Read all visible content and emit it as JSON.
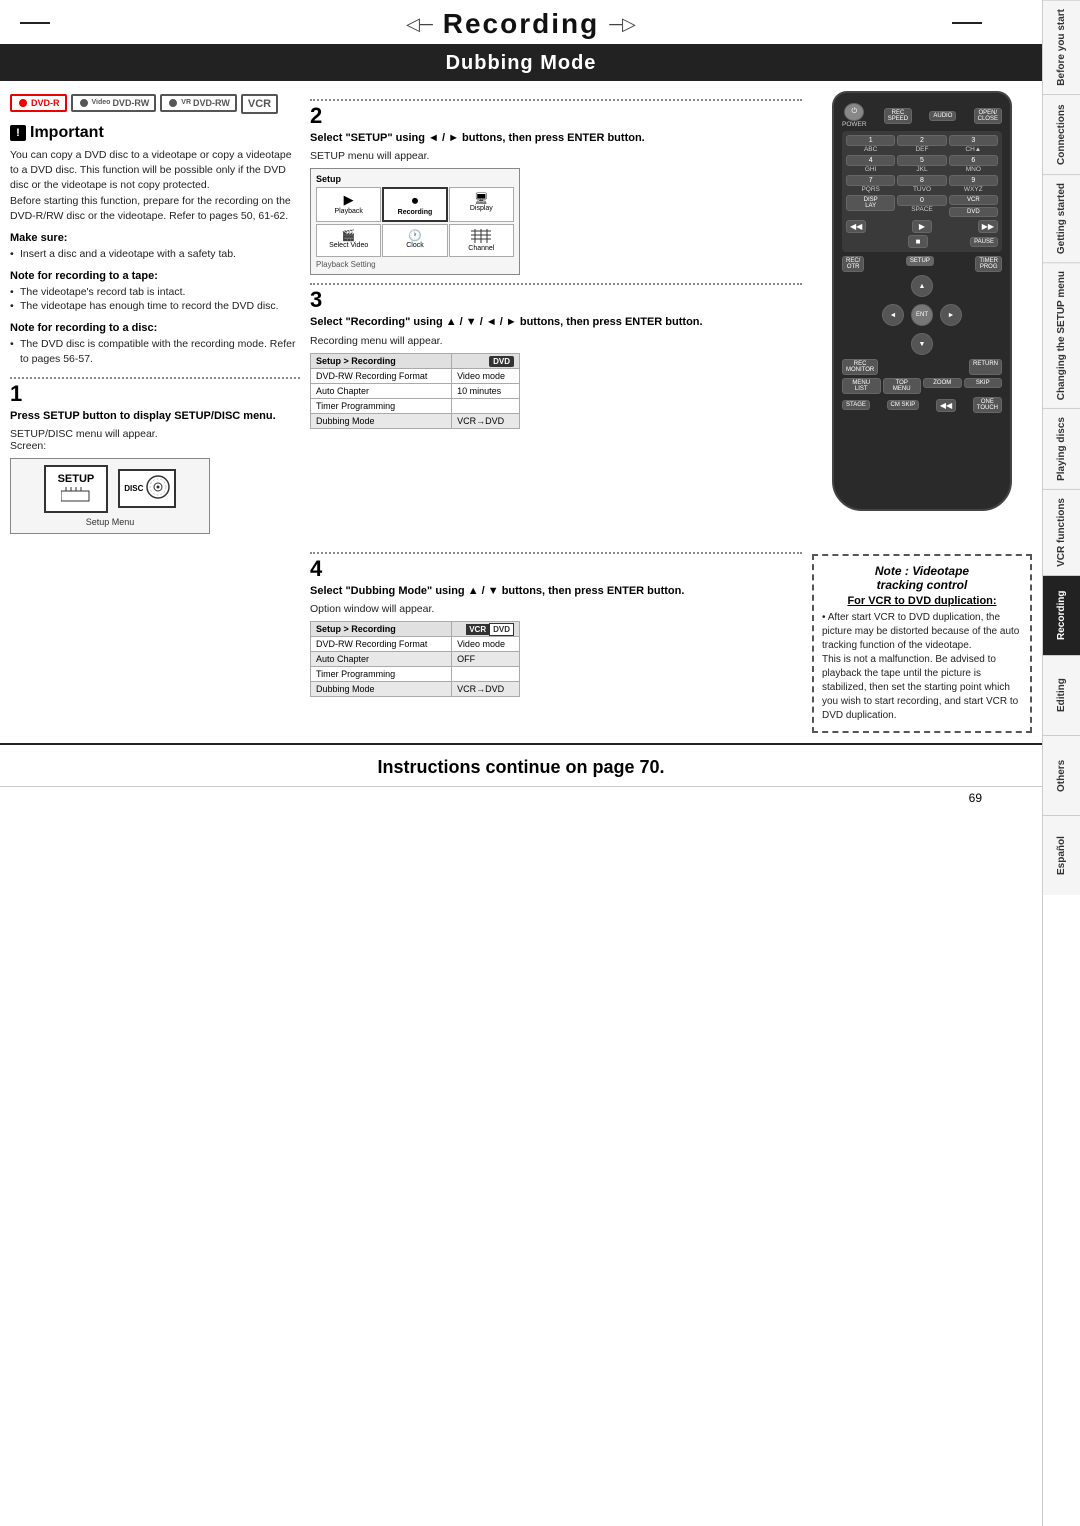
{
  "page": {
    "title": "Recording",
    "subtitle": "Dubbing Mode",
    "page_number": "69"
  },
  "sidebar": {
    "tabs": [
      {
        "label": "Before you start",
        "active": false
      },
      {
        "label": "Connections",
        "active": false
      },
      {
        "label": "Getting started",
        "active": false
      },
      {
        "label": "Changing the SETUP menu",
        "active": false
      },
      {
        "label": "Playing discs",
        "active": false
      },
      {
        "label": "VCR functions",
        "active": false
      },
      {
        "label": "Recording",
        "active": true
      },
      {
        "label": "Editing",
        "active": false
      },
      {
        "label": "Others",
        "active": false
      },
      {
        "label": "Español",
        "active": false
      }
    ]
  },
  "logos": [
    {
      "text": "DVD-R",
      "class": "logo-dvdr"
    },
    {
      "text": "Video DVD-RW",
      "class": "logo-dvdrw-video"
    },
    {
      "text": "VR DVD-RW",
      "class": "logo-dvdrw-vr"
    },
    {
      "text": "VCR",
      "class": "logo-vcr"
    }
  ],
  "important": {
    "title": "Important",
    "body": "You can copy a DVD disc to a videotape or copy a videotape to a DVD disc. This function will be possible only if the DVD disc or the videotape is not copy protected.\nBefore starting this function, prepare for the recording on the DVD-R/RW disc or the videotape. Refer to pages 50, 61-62.",
    "make_sure": {
      "title": "Make sure:",
      "items": [
        "Insert a disc and a videotape with a safety tab."
      ]
    },
    "note_tape": {
      "title": "Note for recording to a tape:",
      "items": [
        "The videotape's record tab is intact.",
        "The videotape has enough time to record the DVD disc."
      ]
    },
    "note_disc": {
      "title": "Note for recording to a disc:",
      "items": [
        "The DVD disc is compatible with the recording mode. Refer to pages 56-57."
      ]
    }
  },
  "steps": {
    "step1": {
      "number": "1",
      "instruction": "Press SETUP button to display SETUP/DISC menu.",
      "result": "SETUP/DISC menu will appear.\nScreen:",
      "menu_label": "Setup Menu"
    },
    "step2": {
      "number": "2",
      "instruction": "Select \"SETUP\" using ◄ / ► buttons, then press ENTER button.",
      "result": "SETUP menu will appear."
    },
    "step3": {
      "number": "3",
      "instruction": "Select \"Recording\" using ▲ / ▼ / ◄ / ► buttons, then press ENTER button.",
      "result": "Recording menu will appear."
    },
    "step4": {
      "number": "4",
      "instruction": "Select \"Dubbing Mode\" using ▲ / ▼ buttons, then press ENTER button.",
      "result": "Option window will appear."
    }
  },
  "setup_menu": {
    "title": "Setup",
    "cells": [
      {
        "label": "Playback",
        "icon": "▶"
      },
      {
        "label": "Recording",
        "icon": "⏺"
      },
      {
        "label": "Display",
        "icon": "📺"
      },
      {
        "label": "Select Video",
        "icon": "🎞"
      },
      {
        "label": "Clock",
        "icon": "🕐"
      },
      {
        "label": "Channel",
        "icon": "📡"
      }
    ],
    "footer": "Playback Setting"
  },
  "recording_menu": {
    "header_left": "Setup > Recording",
    "header_right": "DVD",
    "rows": [
      {
        "label": "DVD-RW Recording Format",
        "value": "Video mode"
      },
      {
        "label": "Auto Chapter",
        "value": "10 minutes"
      },
      {
        "label": "Timer Programming",
        "value": ""
      },
      {
        "label": "Dubbing Mode",
        "value": "VCR→DVD"
      }
    ]
  },
  "recording_menu2": {
    "header_left": "Setup > Recording",
    "header_right": "VCR DVD",
    "rows": [
      {
        "label": "DVD-RW Recording Format",
        "value": "Video mode"
      },
      {
        "label": "Auto Chapter",
        "value": "OFF"
      },
      {
        "label": "Timer Programming",
        "value": ""
      },
      {
        "label": "Dubbing Mode",
        "value": "VCR→DVD"
      }
    ]
  },
  "note_videotape": {
    "title": "Note : Videotape tracking control",
    "subtitle": "For VCR to DVD duplication:",
    "text": "• After start VCR to DVD duplication, the picture may be distorted because of the auto tracking function of the videotape.\nThis is not a malfunction. Be advised to playback the tape until the picture is stabilized, then set the starting point which you wish to start recording, and start VCR to DVD duplication."
  },
  "bottom_note": "Instructions continue on page 70.",
  "remote": {
    "buttons": {
      "power": "POWER",
      "rec_speed": "REC SPEED",
      "audio": "AUDIO",
      "open_close": "OPEN/CLOSE",
      "display": "DISPLAY",
      "vcr": "VCR",
      "dvd": "DVD",
      "pause": "PAUSE",
      "rec_otr": "REC/OTR",
      "setup": "SETUP",
      "timer_prog": "TIMER PROG",
      "rec_monitor": "REC MONITOR",
      "enter": "ENTER",
      "return": "RETURN"
    }
  },
  "step_side_numbers": [
    "1",
    "2",
    "3",
    "4"
  ]
}
